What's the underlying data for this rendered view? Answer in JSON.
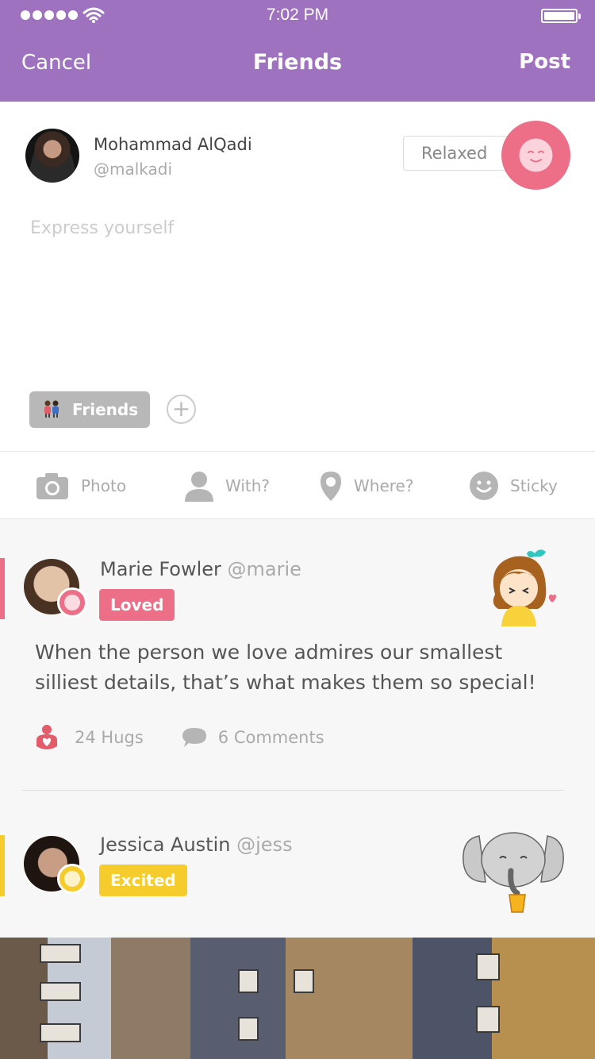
{
  "status_bar": {
    "time": "7:02 PM"
  },
  "nav": {
    "cancel_label": "Cancel",
    "title": "Friends",
    "post_label": "Post"
  },
  "composer": {
    "user_name": "Mohammad AlQadi",
    "user_handle": "@malkadi",
    "mood_label": "Relaxed",
    "placeholder": "Express yourself",
    "audience_label": "Friends",
    "add_label": "+"
  },
  "actions": [
    {
      "label": "Photo",
      "icon": "camera-icon"
    },
    {
      "label": "With?",
      "icon": "person-icon"
    },
    {
      "label": "Where?",
      "icon": "location-pin-icon"
    },
    {
      "label": "Sticky",
      "icon": "smiley-icon"
    }
  ],
  "feed": [
    {
      "name": "Marie Fowler",
      "handle": "@marie",
      "mood": "Loved",
      "mood_color": "#ec6f87",
      "text": "When the person we love admires our smallest silliest details, that’s what makes them so special!",
      "hugs": "24 Hugs",
      "comments": "6 Comments",
      "sticker": "shy-girl-sticker"
    },
    {
      "name": "Jessica Austin",
      "handle": "@jess",
      "mood": "Excited",
      "mood_color": "#f5cc2b",
      "sticker": "elephant-drink-sticker"
    }
  ],
  "colors": {
    "accent": "#9e72bf",
    "loved": "#ec6f87",
    "excited": "#f5cc2b"
  }
}
